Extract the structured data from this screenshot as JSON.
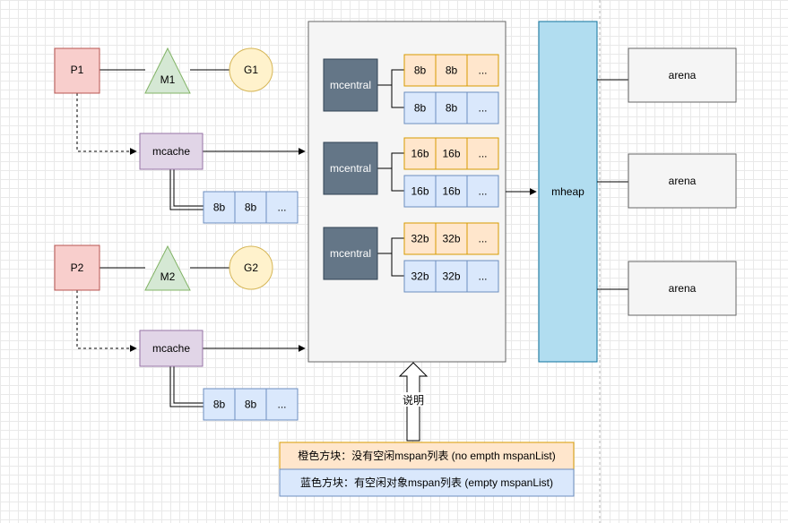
{
  "colors": {
    "p_fill": "#f8cecc",
    "p_stroke": "#b85450",
    "m_fill": "#d5e8d4",
    "m_stroke": "#82b366",
    "g_fill": "#fff2cc",
    "g_stroke": "#d6b656",
    "mcache_fill": "#e1d5e7",
    "mcache_stroke": "#9673a6",
    "blue_fill": "#dae8fc",
    "blue_stroke": "#6c8ebf",
    "orange_fill": "#ffe6cc",
    "orange_stroke": "#d79b00",
    "mcentral_fill": "#647687",
    "mcentral_stroke": "#314354",
    "mheap_fill": "#b1ddf0",
    "mheap_stroke": "#10739e",
    "container_fill": "#f5f5f5",
    "container_stroke": "#666666",
    "arena_fill": "#f5f5f5",
    "arena_stroke": "#666666"
  },
  "processors": [
    {
      "p": "P1",
      "m": "M1",
      "g": "G1",
      "mcache": "mcache",
      "cache_spans": [
        "8b",
        "8b",
        "..."
      ]
    },
    {
      "p": "P2",
      "m": "M2",
      "g": "G2",
      "mcache": "mcache",
      "cache_spans": [
        "8b",
        "8b",
        "..."
      ]
    }
  ],
  "mcentrals": [
    {
      "label": "mcentral",
      "orange_row": [
        "8b",
        "8b",
        "..."
      ],
      "blue_row": [
        "8b",
        "8b",
        "..."
      ]
    },
    {
      "label": "mcentral",
      "orange_row": [
        "16b",
        "16b",
        "..."
      ],
      "blue_row": [
        "16b",
        "16b",
        "..."
      ]
    },
    {
      "label": "mcentral",
      "orange_row": [
        "32b",
        "32b",
        "..."
      ],
      "blue_row": [
        "32b",
        "32b",
        "..."
      ]
    }
  ],
  "mheap": {
    "label": "mheap"
  },
  "arenas": [
    "arena",
    "arena",
    "arena"
  ],
  "callout": {
    "label": "说明"
  },
  "legend": {
    "orange": "橙色方块：没有空闲mspan列表 (no empth mspanList)",
    "blue": "蓝色方块：有空闲对象mspan列表  (empty mspanList)"
  }
}
